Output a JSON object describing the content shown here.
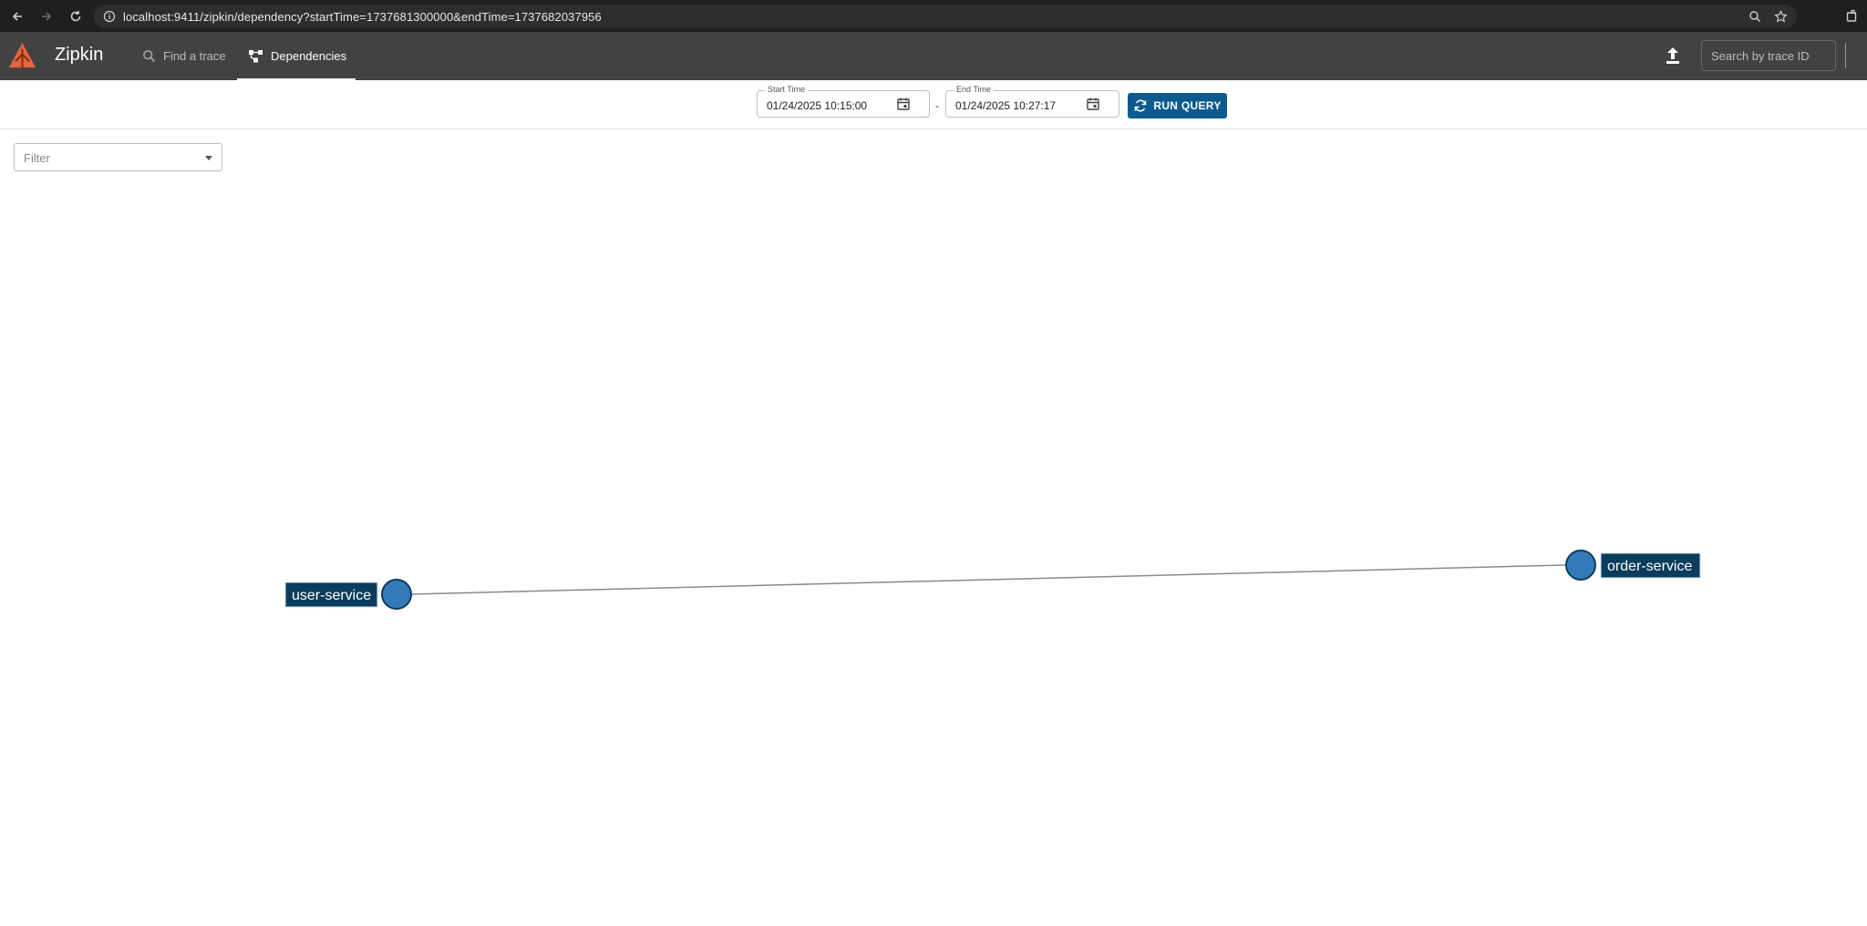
{
  "browser": {
    "url": "localhost:9411/zipkin/dependency?startTime=1737681300000&endTime=1737682037956"
  },
  "header": {
    "brand": "Zipkin",
    "nav": {
      "find_trace": "Find a trace",
      "dependencies": "Dependencies"
    },
    "search_placeholder": "Search by trace ID"
  },
  "query": {
    "start_label": "Start Time",
    "start_value": "01/24/2025 10:15:00",
    "separator": "-",
    "end_label": "End Time",
    "end_value": "01/24/2025 10:27:17",
    "run_label": "RUN QUERY"
  },
  "filter": {
    "placeholder": "Filter"
  },
  "graph": {
    "nodes": [
      {
        "id": "user-service",
        "label": "user-service"
      },
      {
        "id": "order-service",
        "label": "order-service"
      }
    ],
    "edges": [
      {
        "from": "user-service",
        "to": "order-service"
      }
    ]
  },
  "colors": {
    "header_bg": "#424242",
    "accent": "#0d5b8e",
    "node_fill": "#337ab7",
    "node_label_bg": "#0a3d5c",
    "logo": "#e8643c"
  }
}
